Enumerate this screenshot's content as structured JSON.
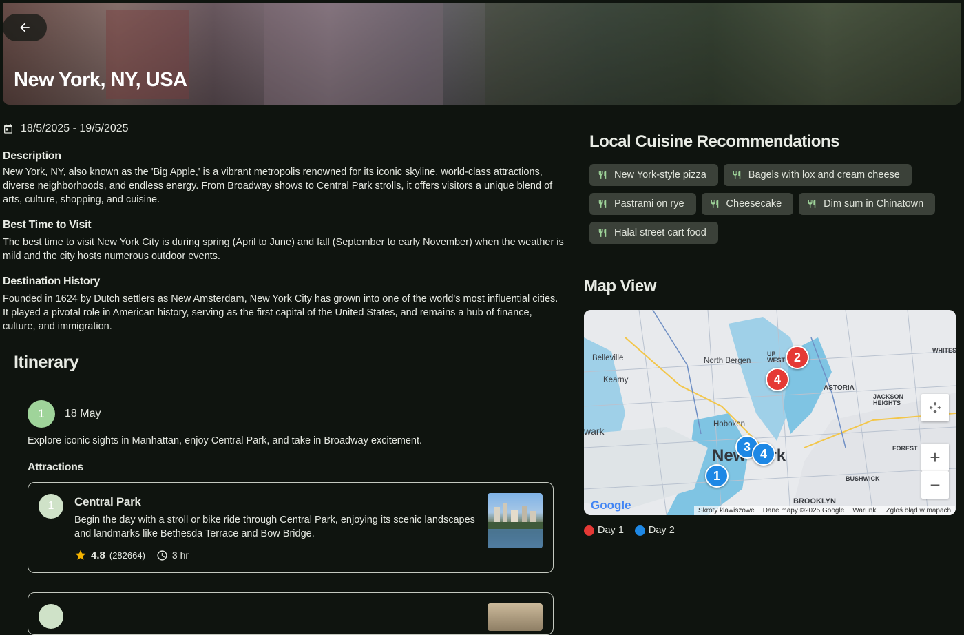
{
  "header": {
    "title": "New York, NY, USA"
  },
  "trip": {
    "dates": "18/5/2025 - 19/5/2025"
  },
  "sections": {
    "description": {
      "title": "Description",
      "text": "New York, NY, also known as the 'Big Apple,' is a vibrant metropolis renowned for its iconic skyline, world-class attractions, diverse neighborhoods, and endless energy. From Broadway shows to Central Park strolls, it offers visitors a unique blend of arts, culture, shopping, and cuisine."
    },
    "best_time": {
      "title": "Best Time to Visit",
      "text": "The best time to visit New York City is during spring (April to June) and fall (September to early November) when the weather is mild and the city hosts numerous outdoor events."
    },
    "history": {
      "title": "Destination History",
      "text": "Founded in 1624 by Dutch settlers as New Amsterdam, New York City has grown into one of the world's most influential cities. It played a pivotal role in American history, serving as the first capital of the United States, and remains a hub of finance, culture, and immigration."
    }
  },
  "itinerary": {
    "title": "Itinerary",
    "day": {
      "number": "1",
      "label": "18 May",
      "description": "Explore iconic sights in Manhattan, enjoy Central Park, and take in Broadway excitement."
    },
    "attractions_title": "Attractions",
    "attraction": {
      "number": "1",
      "name": "Central Park",
      "description": "Begin the day with a stroll or bike ride through Central Park, enjoying its scenic landscapes and landmarks like Bethesda Terrace and Bow Bridge.",
      "rating": "4.8",
      "reviews": "(282664)",
      "duration": "3 hr"
    }
  },
  "cuisine": {
    "title": "Local Cuisine Recommendations",
    "items": [
      "New York-style pizza",
      "Bagels with lox and cream cheese",
      "Pastrami on rye",
      "Cheesecake",
      "Dim sum in Chinatown",
      "Halal street cart food"
    ]
  },
  "map": {
    "title": "Map View",
    "markers": {
      "day1": [
        "2",
        "4"
      ],
      "day2": [
        "3",
        "4",
        "1"
      ]
    },
    "labels": {
      "belleville": "Belleville",
      "kearny": "Kearny",
      "north_bergen": "North Bergen",
      "hoboken": "Hoboken",
      "astoria": "ASTORIA",
      "jackson_heights": "JACKSON HEIGHTS",
      "forest": "FOREST",
      "bushwick": "BUSHWICK",
      "brooklyn": "BROOKLYN",
      "new_york": "New York",
      "newark": "wark",
      "white": "WHITES",
      "upper_west": "UP WEST"
    },
    "google": "Google",
    "footer": [
      "Skróty klawiszowe",
      "Dane mapy ©2025 Google",
      "Warunki",
      "Zgłoś błąd w mapach"
    ],
    "zoom_in": "+",
    "zoom_out": "−"
  },
  "legend": {
    "day1": "Day 1",
    "day2": "Day 2"
  },
  "colors": {
    "day1": "#e53935",
    "day2": "#1e88e5",
    "accent": "#9fd49a",
    "star": "#f5b400"
  }
}
